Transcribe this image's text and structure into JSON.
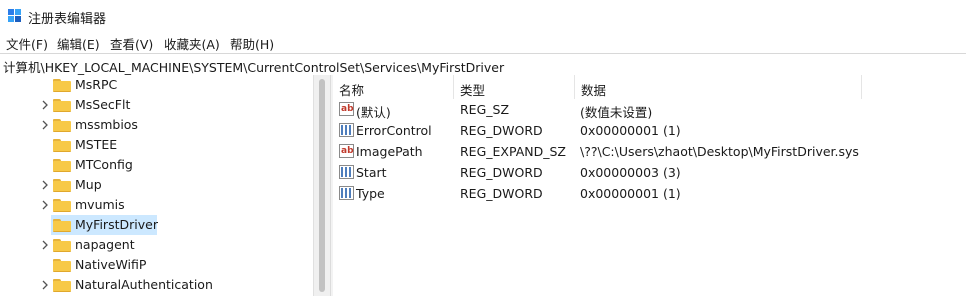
{
  "window": {
    "title": "注册表编辑器",
    "app_icon": "regedit-icon"
  },
  "menu": [
    {
      "label": "文件(F)"
    },
    {
      "label": "编辑(E)"
    },
    {
      "label": "查看(V)"
    },
    {
      "label": "收藏夹(A)"
    },
    {
      "label": "帮助(H)"
    }
  ],
  "address": {
    "path": "计算机\\HKEY_LOCAL_MACHINE\\SYSTEM\\CurrentControlSet\\Services\\MyFirstDriver"
  },
  "tree": {
    "items": [
      {
        "label": "MsRPC",
        "expandable": false
      },
      {
        "label": "MsSecFlt",
        "expandable": true
      },
      {
        "label": "mssmbios",
        "expandable": true
      },
      {
        "label": "MSTEE",
        "expandable": false
      },
      {
        "label": "MTConfig",
        "expandable": false
      },
      {
        "label": "Mup",
        "expandable": true
      },
      {
        "label": "mvumis",
        "expandable": true
      },
      {
        "label": "MyFirstDriver",
        "expandable": false,
        "selected": true
      },
      {
        "label": "napagent",
        "expandable": true
      },
      {
        "label": "NativeWifiP",
        "expandable": false
      },
      {
        "label": "NaturalAuthentication",
        "expandable": true
      }
    ]
  },
  "columns": {
    "name": "名称",
    "type": "类型",
    "data": "数据"
  },
  "values": [
    {
      "icon": "string-value-icon",
      "name": "(默认)",
      "type": "REG_SZ",
      "data": "(数值未设置)"
    },
    {
      "icon": "binary-value-icon",
      "name": "ErrorControl",
      "type": "REG_DWORD",
      "data": "0x00000001 (1)"
    },
    {
      "icon": "string-value-icon",
      "name": "ImagePath",
      "type": "REG_EXPAND_SZ",
      "data": "\\??\\C:\\Users\\zhaot\\Desktop\\MyFirstDriver.sys"
    },
    {
      "icon": "binary-value-icon",
      "name": "Start",
      "type": "REG_DWORD",
      "data": "0x00000003 (3)"
    },
    {
      "icon": "binary-value-icon",
      "name": "Type",
      "type": "REG_DWORD",
      "data": "0x00000001 (1)"
    }
  ]
}
